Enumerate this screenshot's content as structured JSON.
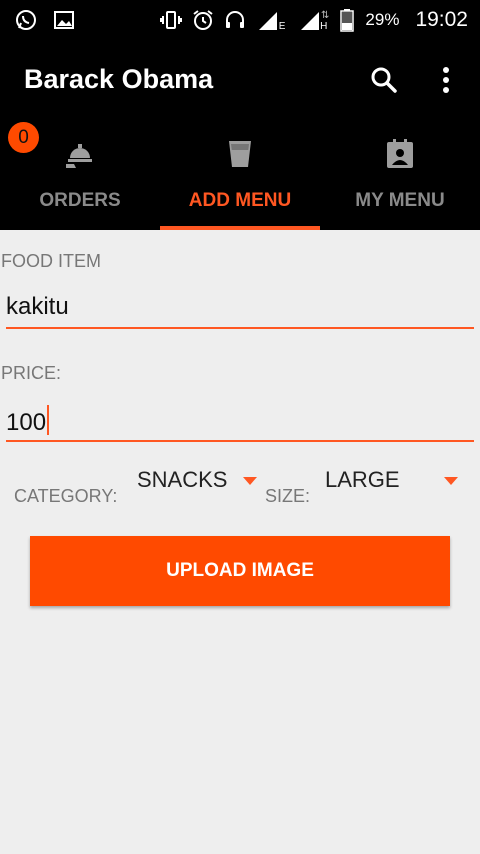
{
  "status_bar": {
    "left_icons": [
      "whatsapp-icon",
      "gallery-icon"
    ],
    "right_icons": [
      "vibrate-icon",
      "alarm-icon",
      "headset-icon",
      "signal-e-icon",
      "signal-h-icon",
      "battery-icon"
    ],
    "network_e": "E",
    "network_h": "H",
    "battery_percent": "29%",
    "time": "19:02"
  },
  "app_bar": {
    "title": "Barack Obama",
    "actions": [
      "search-icon",
      "overflow-menu-icon"
    ]
  },
  "tabs": [
    {
      "label": "ORDERS",
      "icon": "food-tray-icon",
      "badge": "0",
      "active": false
    },
    {
      "label": "ADD MENU",
      "icon": "cup-icon",
      "active": true
    },
    {
      "label": "MY MENU",
      "icon": "clipboard-person-icon",
      "active": false
    }
  ],
  "form": {
    "food_item_label": "FOOD ITEM",
    "food_item_value": "kakitu",
    "price_label": "PRICE:",
    "price_value": "100",
    "category_label": "CATEGORY:",
    "category_value": "SNACKS",
    "size_label": "SIZE:",
    "size_value": "LARGE",
    "upload_button": "UPLOAD IMAGE"
  },
  "colors": {
    "accent": "#ff5722",
    "button": "#ff4a00",
    "background": "#eeeeee",
    "bar": "#000000"
  }
}
